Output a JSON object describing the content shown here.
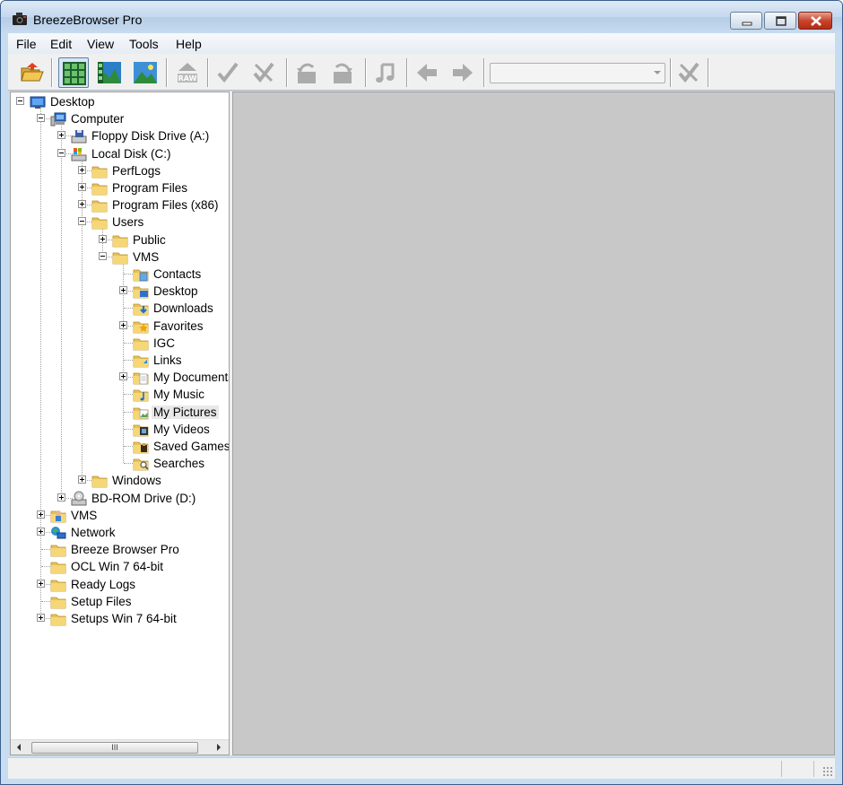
{
  "window": {
    "title": "BreezeBrowser Pro"
  },
  "menu": [
    "File",
    "Edit",
    "View",
    "Tools",
    "Help"
  ],
  "toolbar": {
    "buttons": [
      {
        "name": "open-folder-button",
        "icon": "open-folder-icon",
        "state": "enabled"
      },
      {
        "name": "thumbnail-view-button",
        "icon": "thumbnail-grid-icon",
        "state": "pressed"
      },
      {
        "name": "filmstrip-view-button",
        "icon": "filmstrip-icon",
        "state": "enabled"
      },
      {
        "name": "preview-view-button",
        "icon": "landscape-icon",
        "state": "enabled"
      },
      {
        "name": "raw-button",
        "icon": "raw-icon",
        "state": "disabled"
      },
      {
        "name": "check-button",
        "icon": "checkmark-icon",
        "state": "disabled"
      },
      {
        "name": "uncheck-button",
        "icon": "uncheck-icon",
        "state": "disabled"
      },
      {
        "name": "rotate-left-button",
        "icon": "rotate-left-icon",
        "state": "disabled"
      },
      {
        "name": "rotate-right-button",
        "icon": "rotate-right-icon",
        "state": "disabled"
      },
      {
        "name": "sound-button",
        "icon": "music-note-icon",
        "state": "disabled"
      },
      {
        "name": "back-button",
        "icon": "arrow-left-icon",
        "state": "disabled"
      },
      {
        "name": "forward-button",
        "icon": "arrow-right-icon",
        "state": "disabled"
      },
      {
        "name": "clear-filter-button",
        "icon": "clear-icon",
        "state": "disabled"
      }
    ],
    "combo_value": ""
  },
  "tree": [
    {
      "label": "Desktop",
      "level": 0,
      "icon": "desktop-icon",
      "expander": "minus"
    },
    {
      "label": "Computer",
      "level": 1,
      "icon": "computer-icon",
      "expander": "minus"
    },
    {
      "label": "Floppy Disk Drive (A:)",
      "level": 2,
      "icon": "floppy-drive-icon",
      "expander": "plus"
    },
    {
      "label": "Local Disk (C:)",
      "level": 2,
      "icon": "local-disk-icon",
      "expander": "minus"
    },
    {
      "label": "PerfLogs",
      "level": 3,
      "icon": "folder-icon",
      "expander": "plus"
    },
    {
      "label": "Program Files",
      "level": 3,
      "icon": "folder-icon",
      "expander": "plus"
    },
    {
      "label": "Program Files (x86)",
      "level": 3,
      "icon": "folder-icon",
      "expander": "plus"
    },
    {
      "label": "Users",
      "level": 3,
      "icon": "folder-icon",
      "expander": "minus"
    },
    {
      "label": "Public",
      "level": 4,
      "icon": "folder-icon",
      "expander": "plus"
    },
    {
      "label": "VMS",
      "level": 4,
      "icon": "folder-icon",
      "expander": "minus"
    },
    {
      "label": "Contacts",
      "level": 5,
      "icon": "contacts-folder-icon",
      "expander": "none"
    },
    {
      "label": "Desktop",
      "level": 5,
      "icon": "desktop-folder-icon",
      "expander": "plus"
    },
    {
      "label": "Downloads",
      "level": 5,
      "icon": "downloads-folder-icon",
      "expander": "none"
    },
    {
      "label": "Favorites",
      "level": 5,
      "icon": "favorites-folder-icon",
      "expander": "plus"
    },
    {
      "label": "IGC",
      "level": 5,
      "icon": "folder-icon",
      "expander": "none"
    },
    {
      "label": "Links",
      "level": 5,
      "icon": "links-folder-icon",
      "expander": "none"
    },
    {
      "label": "My Documents",
      "level": 5,
      "icon": "documents-folder-icon",
      "expander": "plus"
    },
    {
      "label": "My Music",
      "level": 5,
      "icon": "music-folder-icon",
      "expander": "none"
    },
    {
      "label": "My Pictures",
      "level": 5,
      "icon": "pictures-folder-icon",
      "expander": "none",
      "selected": true
    },
    {
      "label": "My Videos",
      "level": 5,
      "icon": "videos-folder-icon",
      "expander": "none"
    },
    {
      "label": "Saved Games",
      "level": 5,
      "icon": "saved-games-folder-icon",
      "expander": "none"
    },
    {
      "label": "Searches",
      "level": 5,
      "icon": "searches-folder-icon",
      "expander": "none"
    },
    {
      "label": "Windows",
      "level": 3,
      "icon": "folder-icon",
      "expander": "plus"
    },
    {
      "label": "BD-ROM Drive (D:)",
      "level": 2,
      "icon": "bd-rom-drive-icon",
      "expander": "plus"
    },
    {
      "label": "VMS",
      "level": 1,
      "icon": "user-folder-icon",
      "expander": "plus"
    },
    {
      "label": "Network",
      "level": 1,
      "icon": "network-icon",
      "expander": "plus"
    },
    {
      "label": "Breeze Browser Pro",
      "level": 1,
      "icon": "folder-icon",
      "expander": "none"
    },
    {
      "label": "OCL Win 7 64-bit",
      "level": 1,
      "icon": "folder-icon",
      "expander": "none"
    },
    {
      "label": "Ready Logs",
      "level": 1,
      "icon": "folder-icon",
      "expander": "plus"
    },
    {
      "label": "Setup Files",
      "level": 1,
      "icon": "folder-icon",
      "expander": "none"
    },
    {
      "label": "Setups Win 7 64-bit",
      "level": 1,
      "icon": "folder-icon",
      "expander": "plus"
    }
  ],
  "scrollbar": {
    "thumb_grip": "III"
  },
  "colors": {
    "folder": "#e8c258",
    "preview_bg": "#c8c8c8",
    "selection": "#e8e8e8"
  }
}
